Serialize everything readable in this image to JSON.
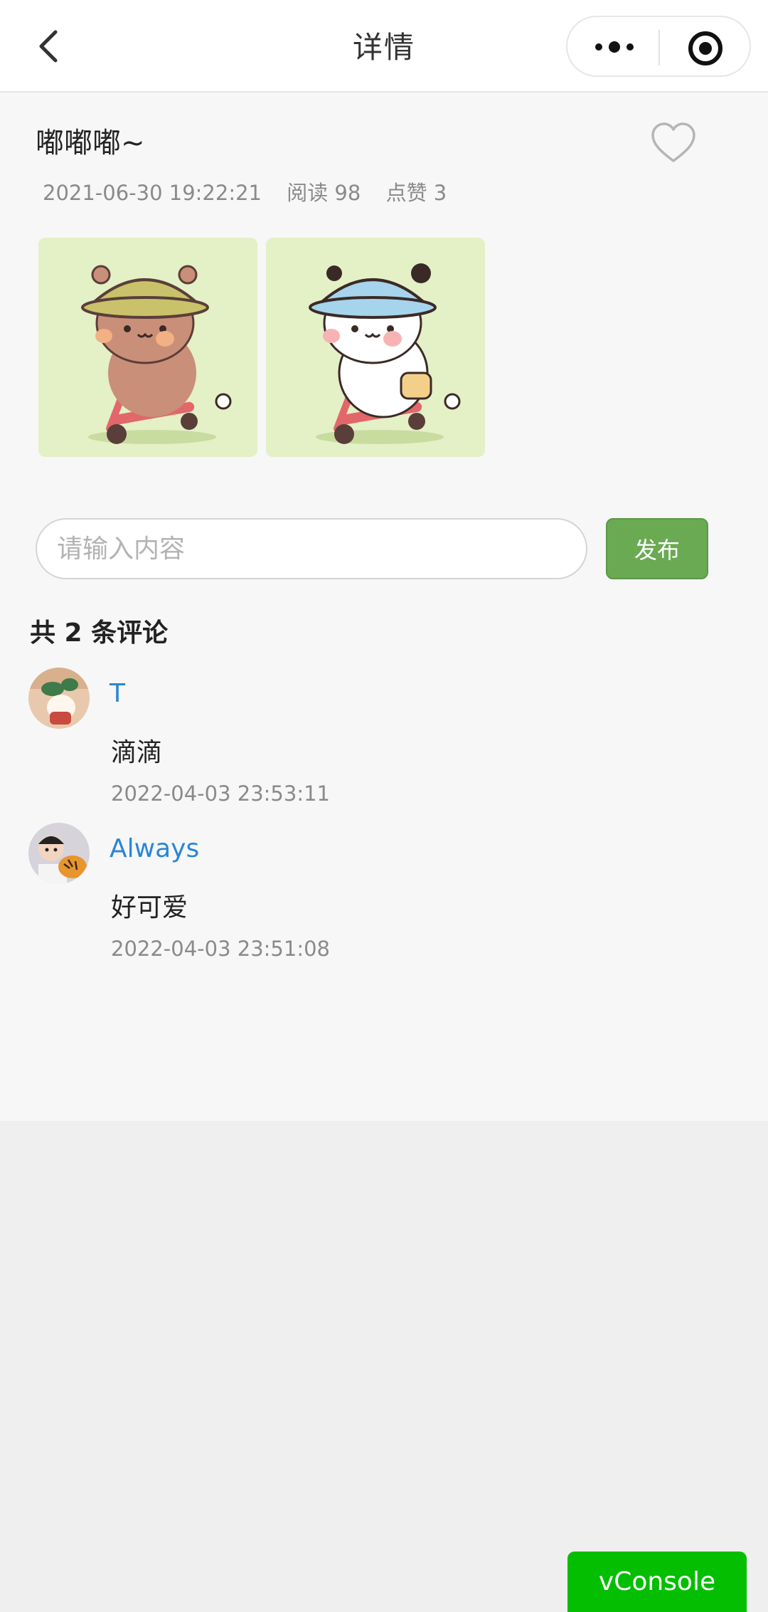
{
  "nav": {
    "title": "详情",
    "back_icon": "chevron-left-icon",
    "more_icon": "more-dots-icon",
    "close_icon": "target-circle-icon"
  },
  "post": {
    "title": "嘟嘟嘟~",
    "datetime": "2021-06-30 19:22:21",
    "reads": "阅读 98",
    "likes": "点赞 3",
    "like_icon": "heart-outline-icon",
    "images": [
      {
        "name": "brown-bear-scooter-image"
      },
      {
        "name": "white-bear-scooter-image"
      }
    ]
  },
  "comment_form": {
    "placeholder": "请输入内容",
    "submit_label": "发布"
  },
  "comments": {
    "count_label": "共 2 条评论",
    "items": [
      {
        "name": "T",
        "text": "滴滴",
        "time": "2022-04-03 23:53:11"
      },
      {
        "name": "Always",
        "text": "好可爱",
        "time": "2022-04-03 23:51:08"
      }
    ]
  },
  "vconsole": {
    "label": "vConsole"
  },
  "colors": {
    "accent_green": "#6aaa53",
    "link_blue": "#2a86d6",
    "vconsole_green": "#04be02"
  }
}
